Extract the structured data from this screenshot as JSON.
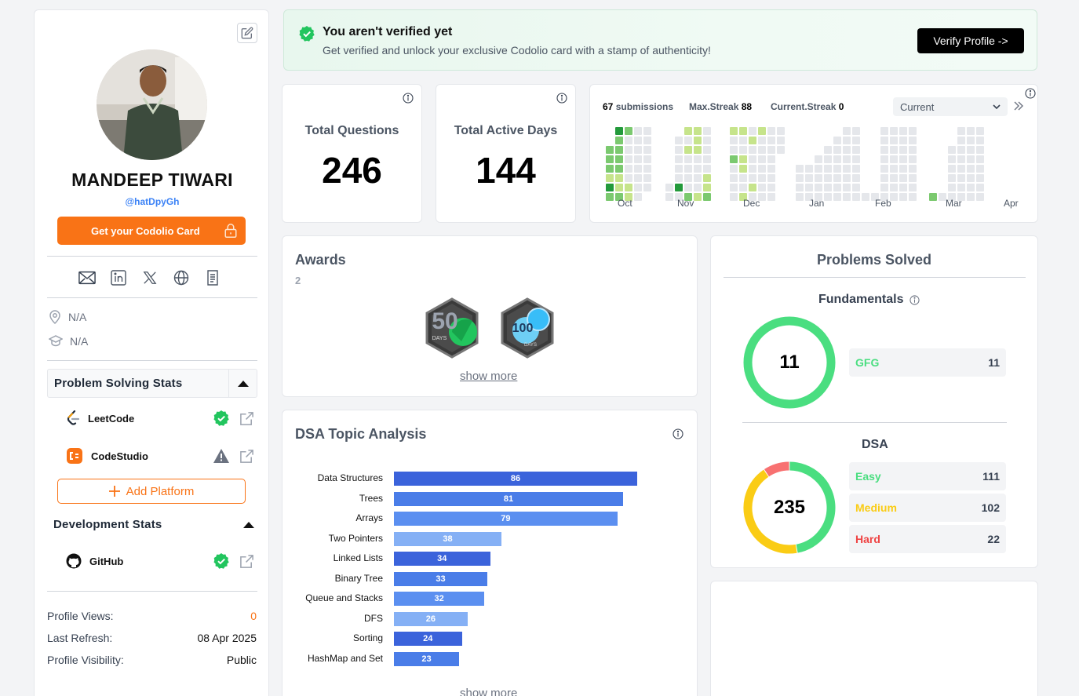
{
  "profile": {
    "name": "MANDEEP TIWARI",
    "handle": "@hatDpyGh",
    "card_button": "Get your Codolio Card",
    "location": "N/A",
    "education": "N/A"
  },
  "social_icons": [
    "mail-icon",
    "linkedin-icon",
    "x-twitter-icon",
    "globe-icon",
    "resume-icon"
  ],
  "problem_solving": {
    "title": "Problem Solving Stats",
    "platforms": [
      {
        "name": "LeetCode",
        "status": "verified"
      },
      {
        "name": "CodeStudio",
        "status": "warning"
      }
    ],
    "add_label": "Add Platform"
  },
  "development": {
    "title": "Development Stats",
    "platforms": [
      {
        "name": "GitHub",
        "status": "verified"
      }
    ]
  },
  "meta": {
    "profile_views_label": "Profile Views:",
    "profile_views": "0",
    "last_refresh_label": "Last Refresh:",
    "last_refresh": "08 Apr 2025",
    "visibility_label": "Profile Visibility:",
    "visibility": "Public"
  },
  "verify": {
    "title": "You aren't verified yet",
    "subtitle": "Get verified and unlock your exclusive Codolio card with a stamp of authenticity!",
    "button": "Verify Profile ->"
  },
  "stats": {
    "total_questions_label": "Total Questions",
    "total_questions": "246",
    "total_active_days_label": "Total Active Days",
    "total_active_days": "144"
  },
  "heatmap": {
    "submissions_count": "67",
    "submissions_label": "submissions",
    "max_streak_label": "Max.Streak",
    "max_streak": "88",
    "current_streak_label": "Current.Streak",
    "current_streak": "0",
    "period": "Current",
    "months": [
      "Oct",
      "Nov",
      "Dec",
      "Jan",
      "Feb",
      "Mar",
      "Apr"
    ]
  },
  "awards": {
    "title": "Awards",
    "count": "2",
    "badges": [
      {
        "caption": "DAYS",
        "number": "50"
      },
      {
        "caption": "DAYS",
        "number": "100"
      }
    ],
    "show_more": "show more"
  },
  "dsa": {
    "title": "DSA Topic Analysis",
    "show_more": "show more"
  },
  "chart_data": {
    "type": "bar",
    "orientation": "horizontal",
    "categories": [
      "Data Structures",
      "Trees",
      "Arrays",
      "Two Pointers",
      "Linked Lists",
      "Binary Tree",
      "Queue and Stacks",
      "DFS",
      "Sorting",
      "HashMap and Set"
    ],
    "values": [
      86,
      81,
      79,
      38,
      34,
      33,
      32,
      26,
      24,
      23
    ],
    "colors": [
      "#3b63db",
      "#4a7de8",
      "#5b8ff0",
      "#85b0f5",
      "#3b63db",
      "#4a7de8",
      "#5b8ff0",
      "#85b0f5",
      "#3b63db",
      "#4a7de8"
    ],
    "xlim": [
      0,
      90
    ]
  },
  "problems_solved": {
    "title": "Problems Solved",
    "fundamentals": {
      "label": "Fundamentals",
      "total": "11",
      "rows": [
        {
          "name": "GFG",
          "value": 11,
          "color": "#4ade80"
        }
      ]
    },
    "dsa": {
      "label": "DSA",
      "total": "235",
      "rows": [
        {
          "name": "Easy",
          "value": 111,
          "color": "#4ade80"
        },
        {
          "name": "Medium",
          "value": 102,
          "color": "#facc15"
        },
        {
          "name": "Hard",
          "value": 22,
          "color": "#f87171"
        }
      ]
    }
  }
}
